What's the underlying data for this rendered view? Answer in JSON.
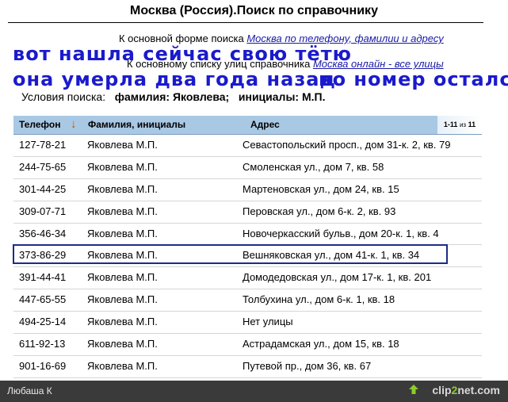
{
  "page": {
    "title": "Москва (Россия).Поиск по справочнику"
  },
  "links": {
    "line1_prefix": "К основной форме поиска",
    "line1_link": "Москва по телефону, фамилии и адресу",
    "line2_prefix": "К основному списку улиц справочника",
    "line2_link": "Москва онлайн - все улицы"
  },
  "notes": {
    "line1": "вот нашла сейчас свою тётю",
    "line2": "она умерла два года назад",
    "line3": "но номер остался"
  },
  "conditions": {
    "label": "Условия поиска:",
    "surname": "фамилия: Яковлева;",
    "initials": "инициалы: М.П."
  },
  "table": {
    "columns": [
      "Телефон",
      "Фамилия, инициалы",
      "Адрес"
    ],
    "sort_icon": "arrow-down-icon",
    "pager_range": "1-11",
    "pager_of": "из",
    "pager_total": "11",
    "rows": [
      {
        "phone": "127-78-21",
        "name": "Яковлева М.П.",
        "address": "Севастопольский просп., дом 31-к. 2, кв. 79"
      },
      {
        "phone": "244-75-65",
        "name": "Яковлева М.П.",
        "address": "Смоленская ул., дом 7, кв. 58"
      },
      {
        "phone": "301-44-25",
        "name": "Яковлева М.П.",
        "address": "Мартеновская ул., дом 24, кв. 15"
      },
      {
        "phone": "309-07-71",
        "name": "Яковлева М.П.",
        "address": "Перовская ул., дом 6-к. 2, кв. 93"
      },
      {
        "phone": "356-46-34",
        "name": "Яковлева М.П.",
        "address": "Новочеркасский бульв., дом 20-к. 1, кв. 4"
      },
      {
        "phone": "373-86-29",
        "name": "Яковлева М.П.",
        "address": "Вешняковская ул., дом 41-к. 1, кв. 34"
      },
      {
        "phone": "391-44-41",
        "name": "Яковлева М.П.",
        "address": "Домодедовская ул., дом 17-к. 1, кв. 201"
      },
      {
        "phone": "447-65-55",
        "name": "Яковлева М.П.",
        "address": "Толбухина ул., дом 6-к. 1, кв. 18"
      },
      {
        "phone": "494-25-14",
        "name": "Яковлева М.П.",
        "address": "Нет улицы"
      },
      {
        "phone": "611-92-13",
        "name": "Яковлева М.П.",
        "address": "Астрадамская ул., дом 15, кв. 18"
      },
      {
        "phone": "901-16-69",
        "name": "Яковлева М.П.",
        "address": "Путевой пр., дом 36, кв. 67"
      }
    ]
  },
  "footer": {
    "user": "Любаша К",
    "brand_prefix": "clip",
    "brand_two": "2",
    "brand_suffix": "net.com",
    "brand_icon": "upload-arrow-icon"
  },
  "colors": {
    "header_bg": "#a9c8e4",
    "note_text": "#1a1acc",
    "link": "#1a1aa6",
    "highlight_border": "#1c2c86",
    "footer_bg": "#3a3a3a",
    "brand_accent": "#8ccc2a"
  }
}
